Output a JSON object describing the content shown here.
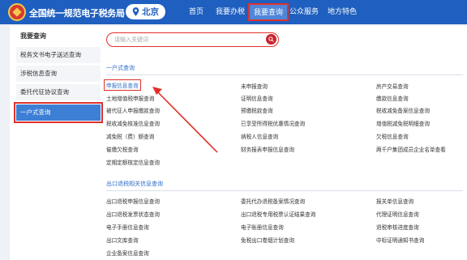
{
  "header": {
    "site_title": "全国统一规范电子税务局",
    "location": "北京",
    "nav": [
      "首页",
      "我要办税",
      "我要查询",
      "公众服务",
      "地方特色"
    ],
    "active_nav": "我要查询"
  },
  "sidebar": {
    "title": "我要查询",
    "items": [
      "税务文书电子送达查询",
      "涉税信息查询",
      "委托代征协议查询",
      "一户式查询"
    ],
    "active_item": "一户式查询"
  },
  "search": {
    "placeholder": "请输入关键词"
  },
  "sections": [
    {
      "title": "一户式查询",
      "rows": [
        [
          "申报信息查询",
          "未申报查询",
          "房产交易查询"
        ],
        [
          "土地增值税申报查询",
          "证明信息查询",
          "缴款信息查询"
        ],
        [
          "被代征人申报缴款查询",
          "预缴税款查询",
          "税收减免备案信息查询"
        ],
        [
          "税收减免核准信息查询",
          "已享受所得税优惠情况查询",
          "增值税减免税明细查询"
        ],
        [
          "减免税（费）额查询",
          "纳税人信息查询",
          "欠税信息查询"
        ],
        [
          "催缴欠税查询",
          "财务报表申报信息查询",
          "两千户集团成员企业名单查看"
        ],
        [
          "定期定额核定信息查询"
        ]
      ]
    },
    {
      "title": "出口退税相关信息查询",
      "rows": [
        [
          "出口退税申报信息查询",
          "委托代办退税备案情况查询",
          "报关单信息查询"
        ],
        [
          "出口退税发票状态查询",
          "出口退税专用税票认证结果查询",
          "代理证明信息查询"
        ],
        [
          "电子手册信息查询",
          "电子账册信息查询",
          "退税审核进度查询"
        ],
        [
          "出口文库查询",
          "免税出口卷烟计划查询",
          "中标证明通知书查询"
        ],
        [
          "企业备案信息查询"
        ]
      ]
    }
  ],
  "colors": {
    "header_bg": "#1f5fbf",
    "highlight": "#e0302a",
    "link_blue": "#2f6ec6",
    "sidebar_active": "#3d7fd4"
  }
}
